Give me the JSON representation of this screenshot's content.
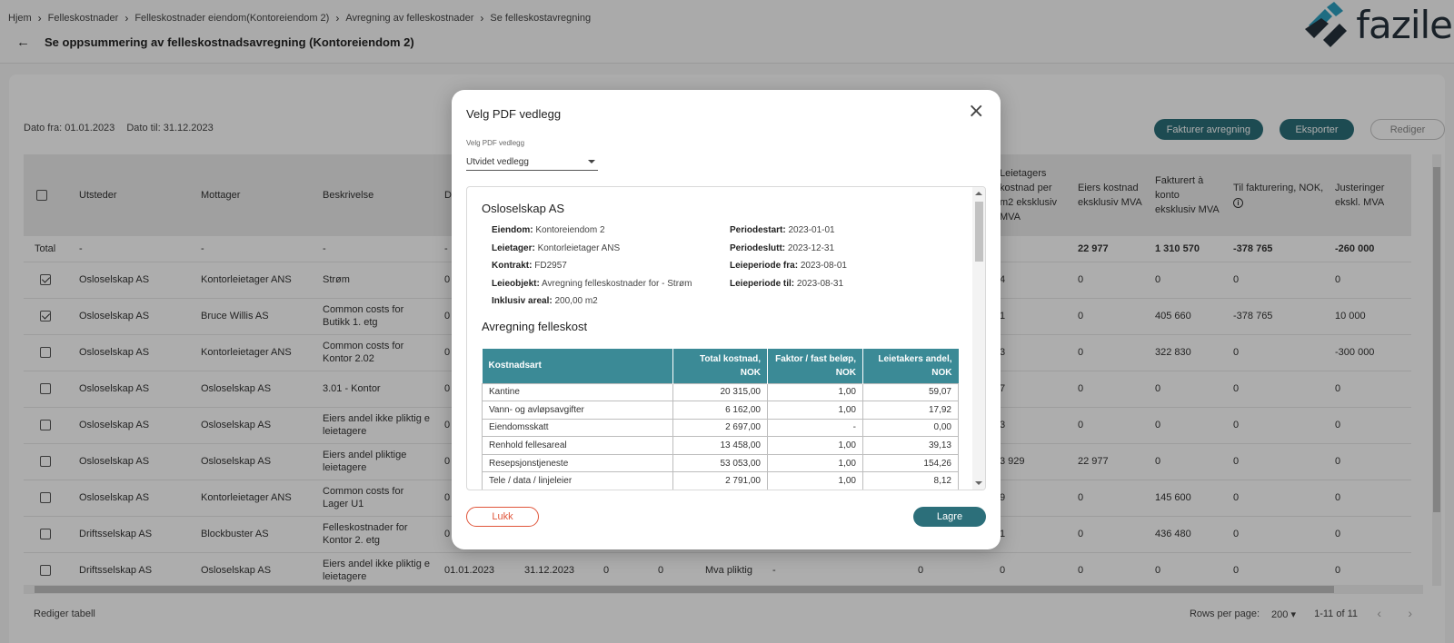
{
  "breadcrumb": [
    "Hjem",
    "Felleskostnader",
    "Felleskostnader eiendom(Kontoreiendom 2)",
    "Avregning av felleskostnader",
    "Se felleskostavregning"
  ],
  "page": {
    "title": "Se oppsummering av felleskostnadsavregning (Kontoreiendom 2)"
  },
  "logo": {
    "text": "fazile"
  },
  "filter": {
    "date_from": "Dato fra: 01.01.2023",
    "date_to": "Dato til: 31.12.2023"
  },
  "actions": {
    "invoice": "Fakturer avregning",
    "export": "Eksporter",
    "edit": "Rediger"
  },
  "table": {
    "headers": [
      "Utsteder",
      "Mottager",
      "Beskrivelse",
      "D",
      "",
      "",
      "",
      "",
      "",
      "",
      "Leietagers kostnad per m2 eksklusiv MVA",
      "Eiers kostnad eksklusiv MVA",
      "Fakturert à konto eksklusiv MVA",
      "Til fakturering, NOK,",
      "Justeringer ekskl. MVA"
    ],
    "total": {
      "label": "Total",
      "utsteder": "-",
      "mottager": "-",
      "beskrivelse": "-",
      "d": "-",
      "eiers": "22 977",
      "fakturert": "1 310 570",
      "til": "-378 765",
      "just": "-260 000"
    },
    "rows": [
      {
        "checked": true,
        "utsteder": "Osloselskap AS",
        "mottager": "Kontorleietager ANS",
        "beskrivelse": "Strøm",
        "d": "0",
        "lt": "4",
        "eiers": "0",
        "fakt": "0",
        "til": "0",
        "just": "0"
      },
      {
        "checked": true,
        "utsteder": "Osloselskap AS",
        "mottager": "Bruce Willis AS",
        "beskrivelse": "Common costs for Butikk 1. etg",
        "d": "0",
        "lt": "1",
        "eiers": "0",
        "fakt": "405 660",
        "til": "-378 765",
        "just": "10 000"
      },
      {
        "checked": false,
        "utsteder": "Osloselskap AS",
        "mottager": "Kontorleietager ANS",
        "beskrivelse": "Common costs for Kontor 2.02",
        "d": "0",
        "lt": "3",
        "eiers": "0",
        "fakt": "322 830",
        "til": "0",
        "just": "-300 000"
      },
      {
        "checked": false,
        "utsteder": "Osloselskap AS",
        "mottager": "Osloselskap AS",
        "beskrivelse": "3.01 - Kontor",
        "d": "0",
        "lt": "7",
        "eiers": "0",
        "fakt": "0",
        "til": "0",
        "just": "0"
      },
      {
        "checked": false,
        "utsteder": "Osloselskap AS",
        "mottager": "Osloselskap AS",
        "beskrivelse": "Eiers andel ikke pliktig e leietagere",
        "d": "0",
        "lt": "3",
        "eiers": "0",
        "fakt": "0",
        "til": "0",
        "just": "0"
      },
      {
        "checked": false,
        "utsteder": "Osloselskap AS",
        "mottager": "Osloselskap AS",
        "beskrivelse": "Eiers andel pliktige leietagere",
        "d": "0",
        "lt": "3 929",
        "eiers": "22 977",
        "fakt": "0",
        "til": "0",
        "just": "0"
      },
      {
        "checked": false,
        "utsteder": "Osloselskap AS",
        "mottager": "Kontorleietager ANS",
        "beskrivelse": "Common costs for Lager U1",
        "d": "0",
        "lt": "9",
        "eiers": "0",
        "fakt": "145 600",
        "til": "0",
        "just": "0"
      },
      {
        "checked": false,
        "utsteder": "Driftsselskap AS",
        "mottager": "Blockbuster AS",
        "beskrivelse": "Felleskostnader for Kontor 2. etg",
        "d": "0",
        "lt": "1",
        "eiers": "0",
        "fakt": "436 480",
        "til": "0",
        "just": "0"
      },
      {
        "checked": false,
        "utsteder": "Driftsselskap AS",
        "mottager": "Osloselskap AS",
        "beskrivelse": "Eiers andel ikke pliktig e leietagere",
        "d": "01.01.2023",
        "d2": "31.12.2023",
        "c1": "0",
        "c2": "0",
        "c3": "Mva pliktig",
        "c4": "-",
        "c5": "0",
        "lt": "0",
        "eiers": "0",
        "fakt": "0",
        "til": "0",
        "just": "0"
      }
    ]
  },
  "footer": {
    "edit_table": "Rediger tabell",
    "rows_per_page": "Rows per page:",
    "rows_value": "200",
    "range": "1-11 of 11"
  },
  "modal": {
    "title": "Velg PDF vedlegg",
    "field_label": "Velg PDF vedlegg",
    "selected": "Utvidet vedlegg",
    "preview": {
      "company": "Osloselskap AS",
      "left": [
        {
          "k": "Eiendom:",
          "v": "Kontoreiendom 2"
        },
        {
          "k": "Leietager:",
          "v": "Kontorleietager ANS"
        },
        {
          "k": "Kontrakt:",
          "v": "FD2957"
        },
        {
          "k": "Leieobjekt:",
          "v": "Avregning felleskostnader for - Strøm"
        },
        {
          "k": "Inklusiv areal:",
          "v": "200,00 m2"
        }
      ],
      "right": [
        {
          "k": "Periodestart:",
          "v": "2023-01-01"
        },
        {
          "k": "Periodeslutt:",
          "v": "2023-12-31"
        },
        {
          "k": "Leieperiode fra:",
          "v": "2023-08-01"
        },
        {
          "k": "Leieperiode til:",
          "v": "2023-08-31"
        }
      ],
      "section": "Avregning felleskost",
      "cost_headers": [
        "Kostnadsart",
        "Total kostnad, NOK",
        "Faktor / fast beløp, NOK",
        "Leietakers andel, NOK"
      ],
      "cost_rows": [
        [
          "Kantine",
          "20 315,00",
          "1,00",
          "59,07"
        ],
        [
          "Vann- og avløpsavgifter",
          "6 162,00",
          "1,00",
          "17,92"
        ],
        [
          "Eiendomsskatt",
          "2 697,00",
          "-",
          "0,00"
        ],
        [
          "Renhold fellesareal",
          "13 458,00",
          "1,00",
          "39,13"
        ],
        [
          "Resepsjonstjeneste",
          "53 053,00",
          "1,00",
          "154,26"
        ],
        [
          "Tele / data / linjeleier",
          "2 791,00",
          "1,00",
          "8,12"
        ]
      ]
    },
    "close_label": "Lukk",
    "save_label": "Lagre"
  },
  "colors": {
    "accent": "#2c6f7a",
    "table_header": "#3b8a96",
    "danger": "#e0553a"
  }
}
